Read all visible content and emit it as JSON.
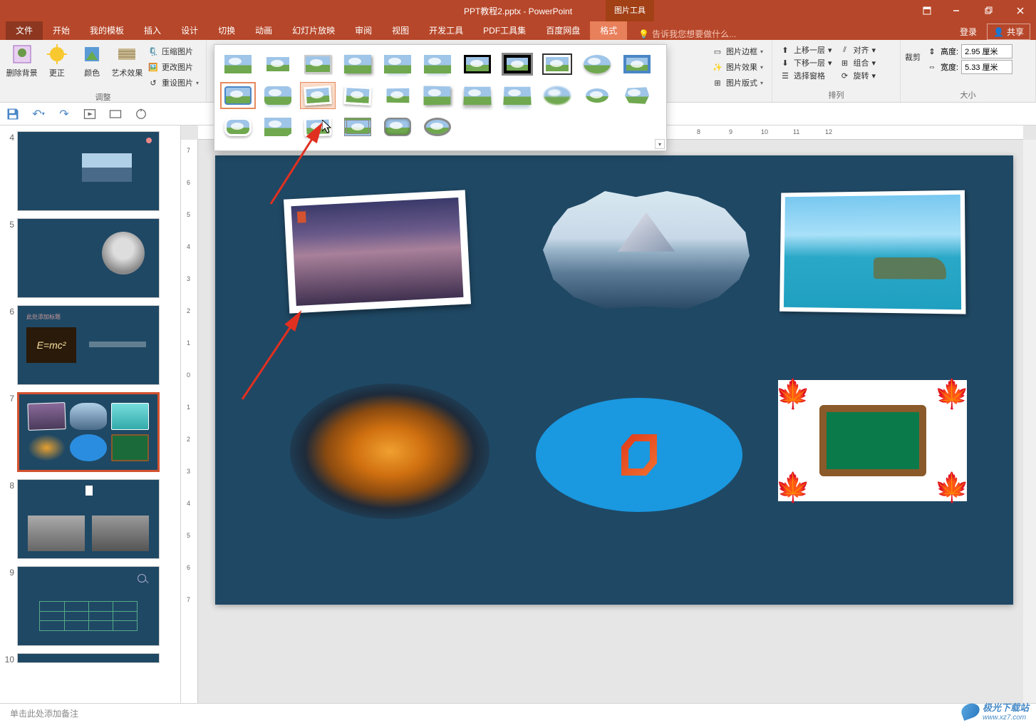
{
  "title": "PPT教程2.pptx - PowerPoint",
  "context_tab": "图片工具",
  "window_controls": {
    "ribbon_options": "功能区显示选项",
    "minimize": "最小化",
    "restore": "向下还原",
    "close": "关闭"
  },
  "tabs": {
    "file": "文件",
    "home": "开始",
    "my_templates": "我的模板",
    "insert": "插入",
    "design": "设计",
    "transitions": "切换",
    "animations": "动画",
    "slideshow": "幻灯片放映",
    "review": "审阅",
    "view": "视图",
    "developer": "开发工具",
    "pdf_tools": "PDF工具集",
    "baidu": "百度网盘",
    "format": "格式"
  },
  "tell_me": "告诉我您想要做什么...",
  "login": "登录",
  "share": "共享",
  "ribbon": {
    "remove_bg": "删除背景",
    "corrections": "更正",
    "color": "颜色",
    "artistic": "艺术效果",
    "compress": "压缩图片",
    "change": "更改图片",
    "reset": "重设图片",
    "adjust_label": "调整",
    "border": "图片边框",
    "effects": "图片效果",
    "layout": "图片版式",
    "bring_forward": "上移一层",
    "send_backward": "下移一层",
    "selection_pane": "选择窗格",
    "align": "对齐",
    "group": "组合",
    "rotate": "旋转",
    "arrange_label": "排列",
    "crop": "裁剪",
    "height_label": "高度:",
    "height_value": "2.95 厘米",
    "width_label": "宽度:",
    "width_value": "5.33 厘米",
    "size_label": "大小"
  },
  "thumbs": {
    "n4": "4",
    "n5": "5",
    "n6": "6",
    "n7": "7",
    "n8": "8",
    "n9": "9",
    "n10": "10",
    "s6_title": "此处添加标题",
    "s6_formula": "E=mc²"
  },
  "ruler_h": [
    "8",
    "9",
    "10",
    "11",
    "12"
  ],
  "ruler_v": [
    "7",
    "6",
    "5",
    "4",
    "3",
    "2",
    "1",
    "0",
    "1",
    "2",
    "3",
    "4",
    "5",
    "6",
    "7"
  ],
  "notes_placeholder": "单击此处添加备注",
  "watermark": {
    "text": "极光下载站",
    "url": "www.xz7.com"
  }
}
